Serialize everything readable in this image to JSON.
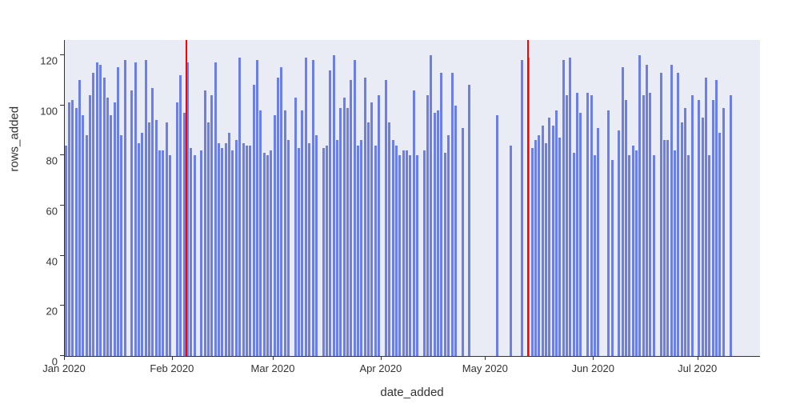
{
  "chart_data": {
    "type": "bar",
    "xlabel": "date_added",
    "ylabel": "rows_added",
    "ylim": [
      0,
      126
    ],
    "y_ticks": [
      0,
      20,
      40,
      60,
      80,
      100,
      120
    ],
    "x_tick_labels": [
      "Jan 2020",
      "Feb 2020",
      "Mar 2020",
      "Apr 2020",
      "May 2020",
      "Jun 2020",
      "Jul 2020"
    ],
    "x_tick_positions": [
      0,
      31,
      60,
      91,
      121,
      152,
      182
    ],
    "total_days": 200,
    "vertical_lines": [
      35,
      133
    ],
    "values": [
      84,
      101,
      102,
      99,
      110,
      96,
      88,
      104,
      113,
      117,
      116,
      111,
      103,
      96,
      101,
      115,
      88,
      118,
      0,
      106,
      117,
      85,
      89,
      118,
      93,
      107,
      94,
      82,
      82,
      93,
      80,
      0,
      101,
      112,
      97,
      117,
      83,
      80,
      0,
      82,
      106,
      93,
      104,
      117,
      85,
      83,
      85,
      89,
      82,
      86,
      119,
      85,
      84,
      84,
      108,
      118,
      98,
      81,
      80,
      82,
      96,
      111,
      115,
      98,
      86,
      0,
      103,
      83,
      98,
      119,
      85,
      118,
      88,
      0,
      83,
      84,
      114,
      120,
      86,
      99,
      103,
      99,
      110,
      118,
      84,
      86,
      111,
      93,
      101,
      84,
      104,
      0,
      110,
      93,
      86,
      84,
      80,
      82,
      82,
      80,
      106,
      80,
      0,
      82,
      104,
      120,
      97,
      98,
      113,
      81,
      88,
      113,
      100,
      0,
      91,
      0,
      108,
      0,
      0,
      0,
      0,
      0,
      0,
      0,
      96,
      0,
      0,
      0,
      84,
      0,
      0,
      118,
      0,
      119,
      83,
      86,
      88,
      92,
      85,
      95,
      92,
      98,
      87,
      118,
      104,
      119,
      81,
      105,
      97,
      0,
      105,
      104,
      80,
      91,
      0,
      0,
      98,
      78,
      0,
      90,
      115,
      102,
      80,
      84,
      82,
      120,
      104,
      116,
      105,
      80,
      0,
      113,
      86,
      86,
      116,
      82,
      113,
      93,
      99,
      80,
      104,
      0,
      102,
      95,
      111,
      80,
      102,
      110,
      89,
      99,
      0,
      104,
      0,
      0,
      0,
      0,
      0,
      0,
      0,
      0
    ]
  }
}
